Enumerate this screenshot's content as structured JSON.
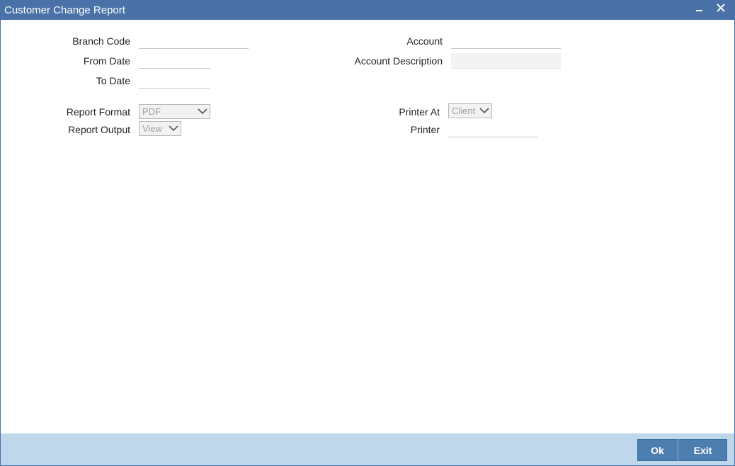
{
  "window": {
    "title": "Customer Change Report"
  },
  "form": {
    "branch_code_label": "Branch Code",
    "branch_code_value": "",
    "from_date_label": "From Date",
    "from_date_value": "",
    "to_date_label": "To Date",
    "to_date_value": "",
    "account_label": "Account",
    "account_value": "",
    "account_description_label": "Account Description",
    "account_description_value": "",
    "report_format_label": "Report Format",
    "report_format_value": "PDF",
    "report_output_label": "Report Output",
    "report_output_value": "View",
    "printer_at_label": "Printer At",
    "printer_at_value": "Client",
    "printer_label": "Printer",
    "printer_value": ""
  },
  "footer": {
    "ok_label": "Ok",
    "exit_label": "Exit"
  },
  "colors": {
    "titlebar": "#4a72a8",
    "footer": "#bed7eb",
    "button": "#4d7eb0"
  },
  "icons": {
    "minimize": "minimize-icon",
    "close": "close-icon",
    "dropdown": "chevron-down-icon"
  }
}
